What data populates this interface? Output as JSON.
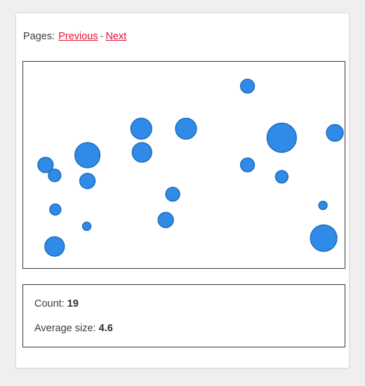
{
  "pager": {
    "label": "Pages:",
    "previous_label": "Previous",
    "separator": "-",
    "next_label": "Next"
  },
  "stats": {
    "count_label": "Count:",
    "count_value": "19",
    "average_label": "Average size:",
    "average_value": "4.6"
  },
  "colors": {
    "page_background": "#f0efef",
    "card_background": "#ffffff",
    "bubble_fill": "#2f8ae8",
    "bubble_stroke": "#1c6bb8",
    "link": "#e0113a",
    "box_border": "#3a3a3a",
    "text": "#3c3c3c"
  },
  "chart_data": {
    "type": "scatter",
    "title": "",
    "xlabel": "",
    "ylabel": "",
    "grid": false,
    "legend": "none",
    "xlim": [
      0,
      460
    ],
    "ylim": [
      0,
      296
    ],
    "count": 19,
    "average_size": 4.6,
    "marker_fill": "#2f8ae8",
    "marker_stroke": "#1c6bb8",
    "points": [
      {
        "x": 321,
        "y": 35,
        "r": 10
      },
      {
        "x": 169,
        "y": 96,
        "r": 15
      },
      {
        "x": 233,
        "y": 96,
        "r": 15
      },
      {
        "x": 370,
        "y": 109,
        "r": 21
      },
      {
        "x": 446,
        "y": 102,
        "r": 12
      },
      {
        "x": 92,
        "y": 134,
        "r": 18
      },
      {
        "x": 170,
        "y": 130,
        "r": 14
      },
      {
        "x": 32,
        "y": 148,
        "r": 11
      },
      {
        "x": 321,
        "y": 148,
        "r": 10
      },
      {
        "x": 45,
        "y": 163,
        "r": 9
      },
      {
        "x": 92,
        "y": 171,
        "r": 11
      },
      {
        "x": 370,
        "y": 165,
        "r": 9
      },
      {
        "x": 214,
        "y": 190,
        "r": 10
      },
      {
        "x": 46,
        "y": 212,
        "r": 8
      },
      {
        "x": 429,
        "y": 206,
        "r": 6
      },
      {
        "x": 91,
        "y": 236,
        "r": 6
      },
      {
        "x": 204,
        "y": 227,
        "r": 11
      },
      {
        "x": 430,
        "y": 253,
        "r": 19
      },
      {
        "x": 45,
        "y": 265,
        "r": 14
      }
    ]
  }
}
